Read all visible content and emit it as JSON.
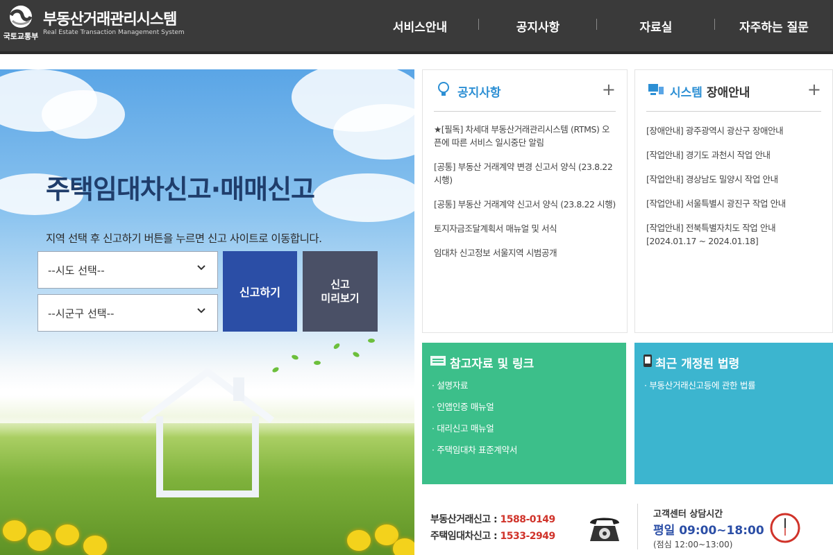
{
  "header": {
    "ministry": "국토교통부",
    "title": "부동산거래관리시스템",
    "subtitle": "Real Estate Transaction Management System",
    "nav": [
      "서비스안내",
      "공지사항",
      "자료실",
      "자주하는 질문"
    ]
  },
  "hero": {
    "title": "주택임대차신고·매매신고",
    "description": "지역 선택 후 신고하기 버튼을 누르면 신고 사이트로 이동합니다.",
    "sido_select": "--시도 선택--",
    "sigungu_select": "--시군구 선택--",
    "report_button": "신고하기",
    "preview_button_line1": "신고",
    "preview_button_line2": "미리보기"
  },
  "notice": {
    "title": "공지사항",
    "plus": "+",
    "items": [
      "★[필독] 차세대 부동산거래관리시스템 (RTMS) 오픈에 따른 서비스 일시중단 알림",
      "[공통] 부동산 거래계약 변경 신고서 양식 (23.8.22 시행)",
      "[공통] 부동산 거래계약 신고서 양식 (23.8.22 시행)",
      "토지자금조달계획서 매뉴얼 및 서식",
      "임대차 신고정보 서울지역 시범공개"
    ]
  },
  "system": {
    "title_blue": "시스템",
    "title_dark": " 장애안내",
    "plus": "+",
    "items": [
      "[장애안내] 광주광역시 광산구 장애안내",
      "[작업안내] 경기도 과천시 작업 안내",
      "[작업안내] 경상남도 밀양시 작업 안내",
      "[작업안내] 서울특별시 광진구 작업 안내",
      "[작업안내] 전북특별자치도 작업 안내 [2024.01.17 ~ 2024.01.18]"
    ]
  },
  "references": {
    "title": "참고자료 및 링크",
    "items": [
      "설명자료",
      "인앱인증 매뉴얼",
      "대리신고 매뉴얼",
      "주택임대차 표준계약서"
    ]
  },
  "laws": {
    "title": "최근 개정된 법령",
    "items": [
      "부동산거래신고등에 관한 법률"
    ]
  },
  "contact": {
    "realestate_label": "부동산거래신고 : ",
    "realestate_number": "1588-0149",
    "lease_label": "주택임대차신고 : ",
    "lease_number": "1533-2949",
    "hours_label": "고객센터 상담시간",
    "hours_weekday": "평일 09:00~18:00",
    "hours_lunch": "(점심 12:00~13:00)"
  },
  "colors": {
    "header_bg": "#3a3a3a",
    "report_button": "#2b4ea6",
    "preview_button": "#4a5066",
    "references_box": "#3cbf8a",
    "laws_box": "#3cb5cf",
    "accent_blue": "#2c8fd4",
    "phone_number": "#d0332a"
  }
}
